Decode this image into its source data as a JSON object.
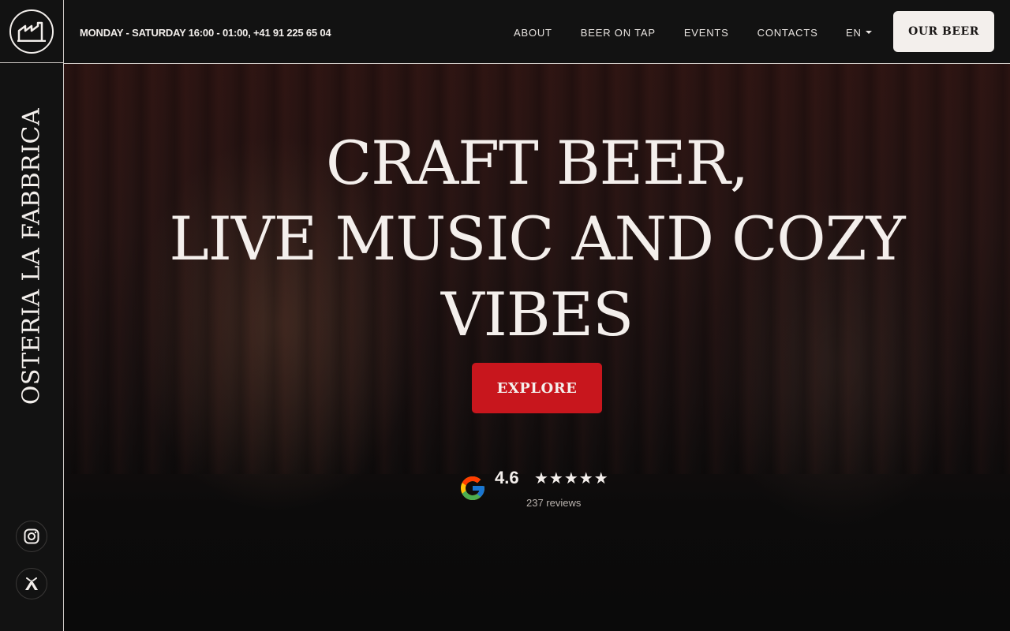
{
  "brand": {
    "name": "OSTERIA LA FABBRICA",
    "logo_icon": "factory-icon"
  },
  "header": {
    "hours": "MONDAY - SATURDAY 16:00 - 01:00, +41 91 225 65 04",
    "nav": [
      {
        "label": "ABOUT"
      },
      {
        "label": "BEER ON TAP"
      },
      {
        "label": "EVENTS"
      },
      {
        "label": "CONTACTS"
      }
    ],
    "language": "EN",
    "cta_label": "OUR BEER"
  },
  "hero": {
    "headline_lines": [
      "CRAFT BEER,",
      "LIVE MUSIC AND COZY",
      "VIBES"
    ],
    "explore_label": "EXPLORE"
  },
  "rating": {
    "provider_icon": "google-icon",
    "score": "4.6",
    "stars": "★★★★★",
    "star_value": 4.6,
    "reviews": "237 reviews"
  },
  "social": [
    {
      "icon": "instagram-icon"
    },
    {
      "icon": "tripadvisor-icon"
    }
  ],
  "colors": {
    "accent_red": "#c8161d",
    "text_light": "#f3efec",
    "panel": "#121212"
  }
}
